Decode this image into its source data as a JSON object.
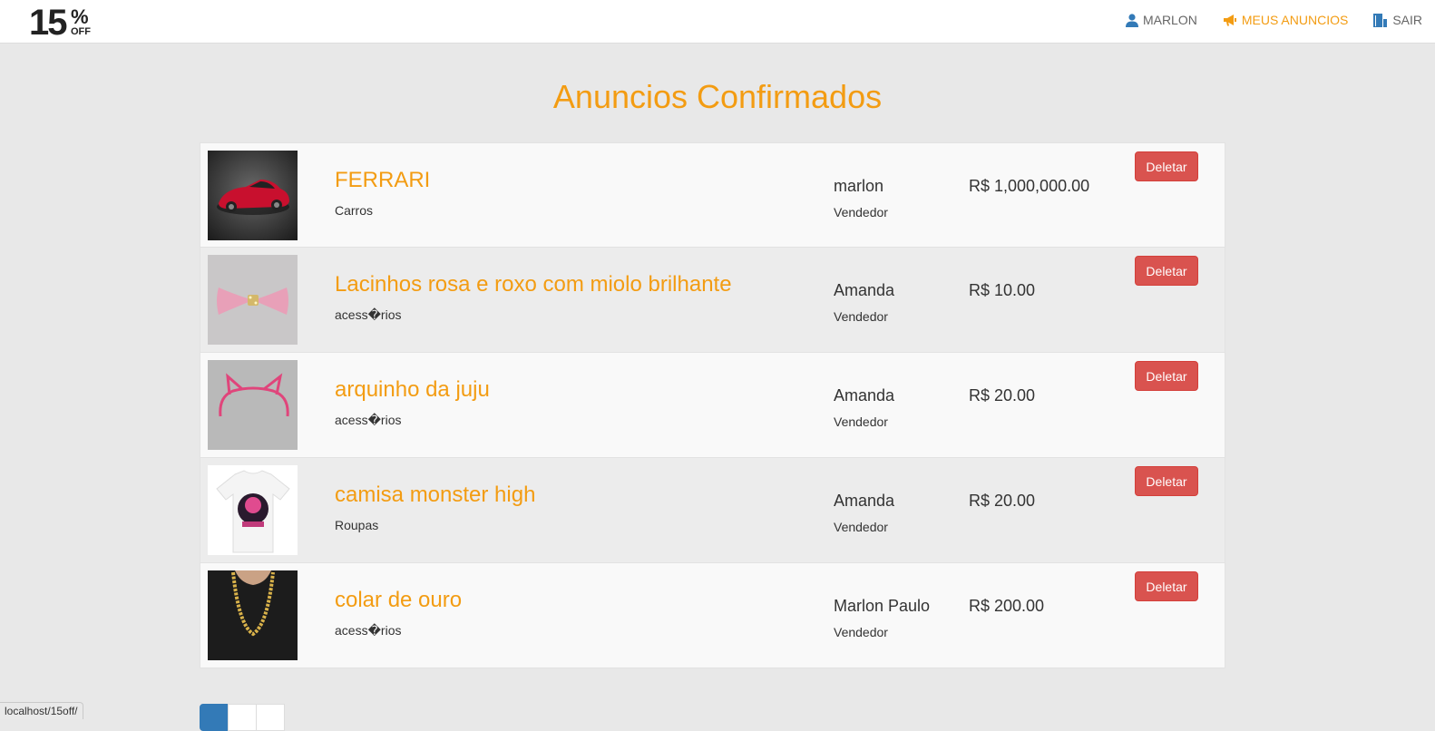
{
  "brand": {
    "number": "15",
    "percent": "%",
    "off": "OFF"
  },
  "nav": {
    "user": "MARLON",
    "my_ads": "MEUS ANUNCIOS",
    "logout": "SAIR"
  },
  "page_title": "Anuncios Confirmados",
  "ads": [
    {
      "title": "FERRARI",
      "category": "Carros",
      "seller": "marlon",
      "seller_role": "Vendedor",
      "price": "R$ 1,000,000.00",
      "delete_label": "Deletar",
      "image": "red sports car"
    },
    {
      "title": "Lacinhos rosa e roxo com miolo brilhante",
      "category": "acess�rios",
      "seller": "Amanda",
      "seller_role": "Vendedor",
      "price": "R$ 10.00",
      "delete_label": "Deletar",
      "image": "pink hair bow"
    },
    {
      "title": "arquinho da juju",
      "category": "acess�rios",
      "seller": "Amanda",
      "seller_role": "Vendedor",
      "price": "R$ 20.00",
      "delete_label": "Deletar",
      "image": "pink cat ear headband"
    },
    {
      "title": "camisa monster high",
      "category": "Roupas",
      "seller": "Amanda",
      "seller_role": "Vendedor",
      "price": "R$ 20.00",
      "delete_label": "Deletar",
      "image": "white t-shirt with pink print"
    },
    {
      "title": "colar de ouro",
      "category": "acess�rios",
      "seller": "Marlon Paulo",
      "seller_role": "Vendedor",
      "price": "R$ 200.00",
      "delete_label": "Deletar",
      "image": "gold chain necklace"
    }
  ],
  "status_url": "localhost/15off/",
  "colors": {
    "accent": "#f39c12",
    "danger": "#d9534f",
    "primary": "#337ab7",
    "background": "#e8e8e8"
  }
}
